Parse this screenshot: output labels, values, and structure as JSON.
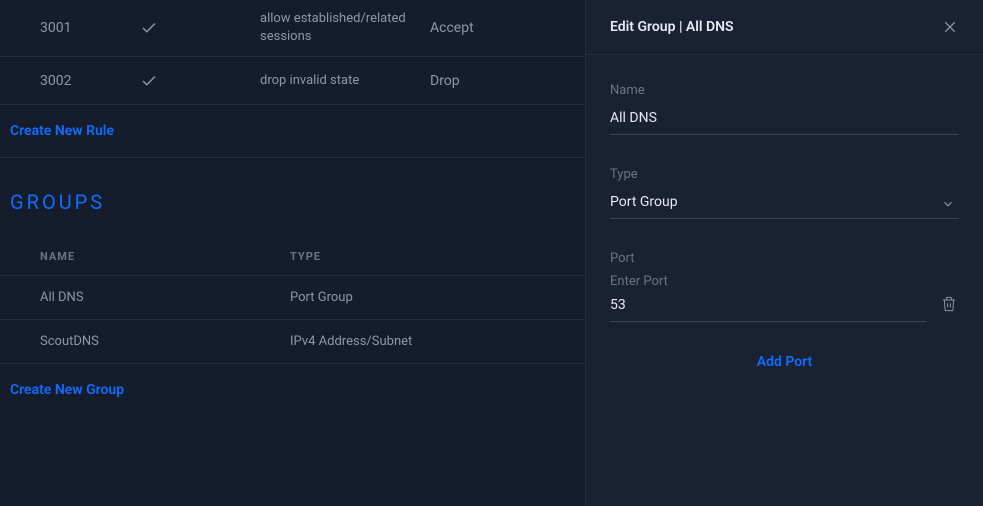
{
  "rules": [
    {
      "id": "3001",
      "description": "allow established/related sessions",
      "action": "Accept"
    },
    {
      "id": "3002",
      "description": "drop invalid state",
      "action": "Drop"
    }
  ],
  "create_rule_label": "Create New Rule",
  "groups_heading": "GROUPS",
  "groups_columns": {
    "name": "NAME",
    "type": "TYPE"
  },
  "groups": [
    {
      "name": "All DNS",
      "type": "Port Group"
    },
    {
      "name": "ScoutDNS",
      "type": "IPv4 Address/Subnet"
    }
  ],
  "create_group_label": "Create New Group",
  "panel": {
    "title": "Edit Group | All DNS",
    "name_label": "Name",
    "name_value": "All DNS",
    "type_label": "Type",
    "type_value": "Port Group",
    "port_label": "Port",
    "port_placeholder": "Enter Port",
    "port_value": "53",
    "add_port_label": "Add Port"
  }
}
